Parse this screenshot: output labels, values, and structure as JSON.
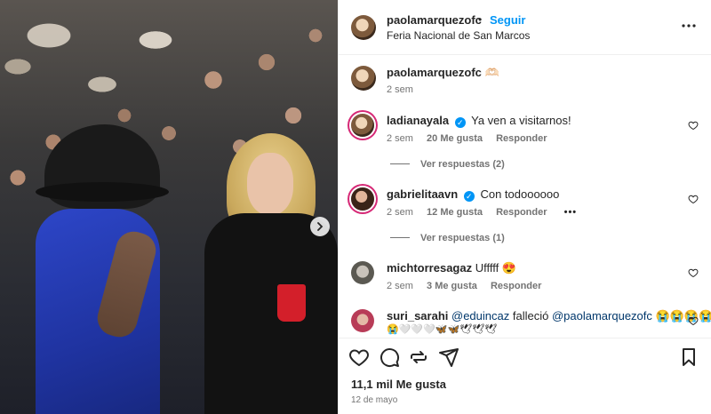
{
  "post": {
    "author": "paolamarquezofc",
    "separator": "•",
    "follow_label": "Seguir",
    "location": "Feria Nacional de San Marcos"
  },
  "caption": {
    "user": "paolamarquezofc",
    "text": "🫶🏻",
    "time": "2 sem"
  },
  "comments": [
    {
      "user": "ladianayala",
      "verified": true,
      "text": "Ya ven a visitarnos!",
      "time": "2 sem",
      "likes": "20 Me gusta",
      "reply_label": "Responder",
      "view_replies": "Ver respuestas (2)"
    },
    {
      "user": "gabrielitaavn",
      "verified": true,
      "text": "Con todoooooo",
      "time": "2 sem",
      "likes": "12 Me gusta",
      "reply_label": "Responder",
      "more": "•••",
      "view_replies": "Ver respuestas (1)"
    },
    {
      "user": "michtorresagaz",
      "verified": false,
      "text": "Ufffff 😍",
      "time": "2 sem",
      "likes": "3 Me gusta",
      "reply_label": "Responder"
    },
    {
      "user": "suri_sarahi",
      "verified": false,
      "mention1": "@eduincaz",
      "text_mid": "falleció",
      "mention2": "@paolamarquezofc",
      "emojis": "😭😭😭😭",
      "line2": "😭🤍🤍🤍🦋🦋🕊🕊🕊"
    }
  ],
  "footer": {
    "likes": "11,1 mil Me gusta",
    "date": "12 de mayo"
  },
  "icons": {
    "like": "heart-icon",
    "comment": "comment-icon",
    "share": "repost-icon",
    "send": "send-icon",
    "save": "bookmark-icon",
    "more": "more-icon",
    "next": "chevron-right-icon"
  },
  "colors": {
    "follow": "#0095f6",
    "verified": "#0095f6",
    "text_muted": "#737373",
    "mention": "#00376b"
  }
}
